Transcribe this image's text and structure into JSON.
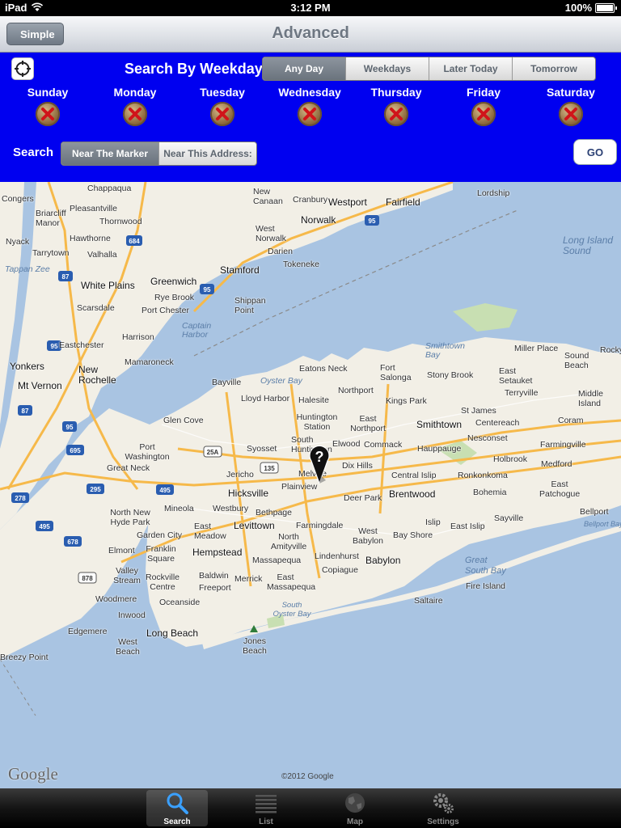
{
  "status_bar": {
    "carrier": "iPad",
    "time": "3:12 PM",
    "battery": "100%"
  },
  "nav": {
    "back_label": "Simple",
    "title": "Advanced"
  },
  "search_panel": {
    "title": "Search By Weekday",
    "day_options": [
      "Any Day",
      "Weekdays",
      "Later Today",
      "Tomorrow"
    ],
    "selected_day_option": "Any Day",
    "weekdays": [
      "Sunday",
      "Monday",
      "Tuesday",
      "Wednesday",
      "Thursday",
      "Friday",
      "Saturday"
    ],
    "search_label": "Search",
    "near_options": [
      "Near The Marker",
      "Near This Address:"
    ],
    "selected_near_option": "Near The Marker",
    "go_label": "GO",
    "colors": {
      "panel": "#0000f0",
      "x_mark": "#d0141a"
    }
  },
  "map": {
    "places": [
      "Congers",
      "Chappaqua",
      "New Canaan",
      "Cranbury",
      "Westport",
      "Fairfield",
      "Lordship",
      "Briarcliff Manor",
      "Pleasantville",
      "Thornwood",
      "Norwalk",
      "Nyack",
      "Hawthorne",
      "West Norwalk",
      "Tarrytown",
      "Valhalla",
      "Darien",
      "Tokeneke",
      "Tappan Zee",
      "Stamford",
      "White Plains",
      "Greenwich",
      "Rye Brook",
      "Shippan Point",
      "Scarsdale",
      "Port Chester",
      "Captain Harbor",
      "Harrison",
      "Eastchester",
      "Mamaroneck",
      "Yonkers",
      "New Rochelle",
      "Mt Vernon",
      "Long Island Sound",
      "Miller Place",
      "Sound Beach",
      "Rocky Point",
      "Smithtown Bay",
      "Eatons Neck",
      "Fort Salonga",
      "Stony Brook",
      "East Setauket",
      "Oyster Bay",
      "Bayville",
      "Northport",
      "Kings Park",
      "St James",
      "Terryville",
      "Middle Island",
      "Lloyd Harbor",
      "Halesite",
      "Huntington Station",
      "East Northport",
      "Smithtown",
      "Centereach",
      "Coram",
      "Glen Cove",
      "Commack",
      "Nesconset",
      "Farmingville",
      "Port Washington",
      "Syosset",
      "South Huntington",
      "Elwood",
      "Hauppauge",
      "Holbrook",
      "Medford",
      "Great Neck",
      "Jericho",
      "Melville",
      "Dix Hills",
      "Central Islip",
      "Ronkonkoma",
      "Plainview",
      "Hicksville",
      "Brentwood",
      "Bohemia",
      "East Patchogue",
      "Deer Park",
      "Mineola",
      "Westbury",
      "Bethpage",
      "North New Hyde Park",
      "Garden City",
      "East Meadow",
      "Levittown",
      "Farmingdale",
      "West Babylon",
      "Bay Shore",
      "East Islip",
      "Islip",
      "Sayville",
      "Bellport",
      "Bellport Bay",
      "Elmont",
      "Franklin Square",
      "Hempstead",
      "North Amityville",
      "Lindenhurst",
      "Babylon",
      "Valley Stream",
      "Rockville Centre",
      "Baldwin",
      "Freeport",
      "Merrick",
      "Massapequa",
      "East Massapequa",
      "Copiague",
      "Great South Bay",
      "Fire Island",
      "Woodmere",
      "Oceanside",
      "Inwood",
      "Saltaire",
      "Long Beach",
      "South Oyster Bay",
      "Edgemere",
      "West Beach",
      "Jones Beach",
      "Breezy Point"
    ],
    "highways": [
      "684",
      "95",
      "87",
      "95",
      "95",
      "695",
      "278",
      "295",
      "495",
      "25A",
      "135",
      "495",
      "678",
      "878",
      "87",
      "95"
    ],
    "google_logo": "Google",
    "copyright": "©2012 Google",
    "marker_symbol": "?"
  },
  "tab_bar": {
    "tabs": [
      {
        "label": "Search",
        "icon": "magnifier-icon",
        "selected": true
      },
      {
        "label": "List",
        "icon": "list-icon",
        "selected": false
      },
      {
        "label": "Map",
        "icon": "globe-icon",
        "selected": false
      },
      {
        "label": "Settings",
        "icon": "gears-icon",
        "selected": false
      }
    ]
  }
}
